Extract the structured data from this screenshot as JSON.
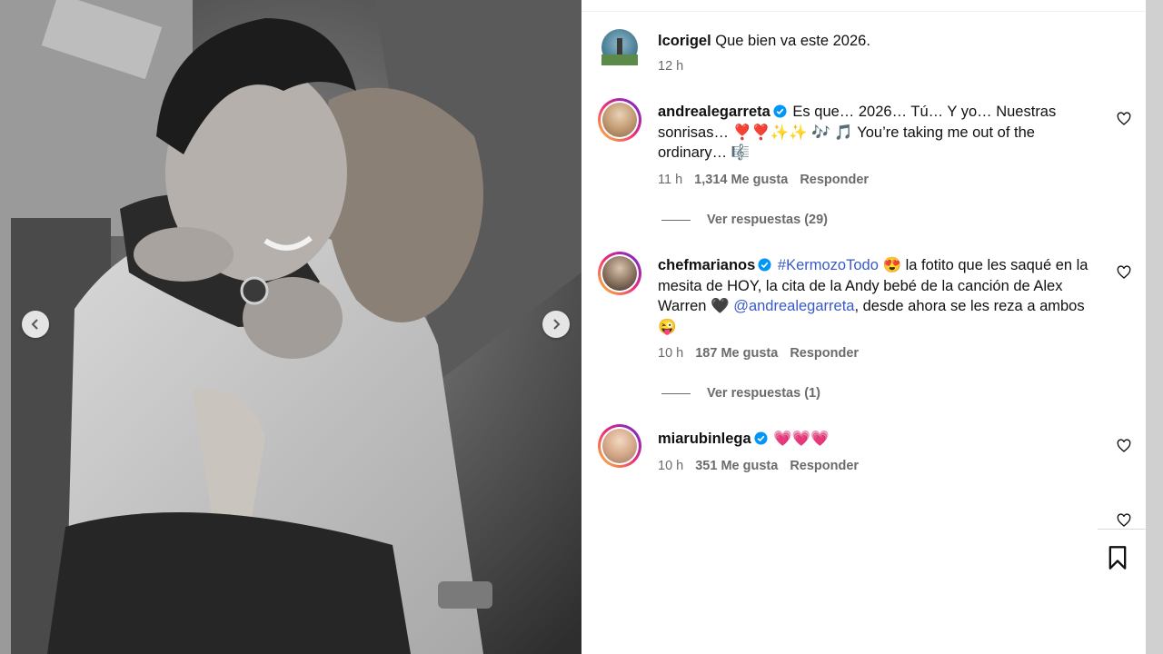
{
  "comments": [
    {
      "username": "lcorigel",
      "text": "Que bien va este 2026.",
      "time": "12 h"
    },
    {
      "username": "andrealegarreta",
      "verified": true,
      "text": "Es que… 2026… Tú… Y yo… Nuestras sonrisas… ❣️❣️✨✨ 🎶 🎵 You’re taking me out of the ordinary… 🎼",
      "time": "11 h",
      "likes": "1,314 Me gusta",
      "reply_label": "Responder",
      "view_replies": "Ver respuestas (29)"
    },
    {
      "username": "chefmarianos",
      "verified": true,
      "hashtag": "#KermozoTodo",
      "text_a": " 😍 la fotito que les saqué en la mesita de HOY, la cita de la Andy bebé de la canción de Alex Warren 🖤 ",
      "mention": "@andrealegarreta",
      "text_b": ", desde ahora se les reza a ambos 😜",
      "time": "10 h",
      "likes": "187 Me gusta",
      "reply_label": "Responder",
      "view_replies": "Ver respuestas (1)"
    },
    {
      "username": "miarubinlega",
      "verified": true,
      "text": "💗💗💗",
      "time": "10 h",
      "likes": "351 Me gusta",
      "reply_label": "Responder"
    }
  ],
  "colors": {
    "verified": "#0095f6",
    "link": "#3a5bc7",
    "muted": "#6b6b6b"
  },
  "icons": [
    "chevron-left-icon",
    "chevron-right-icon",
    "heart-icon",
    "verified-icon",
    "bookmark-icon"
  ]
}
